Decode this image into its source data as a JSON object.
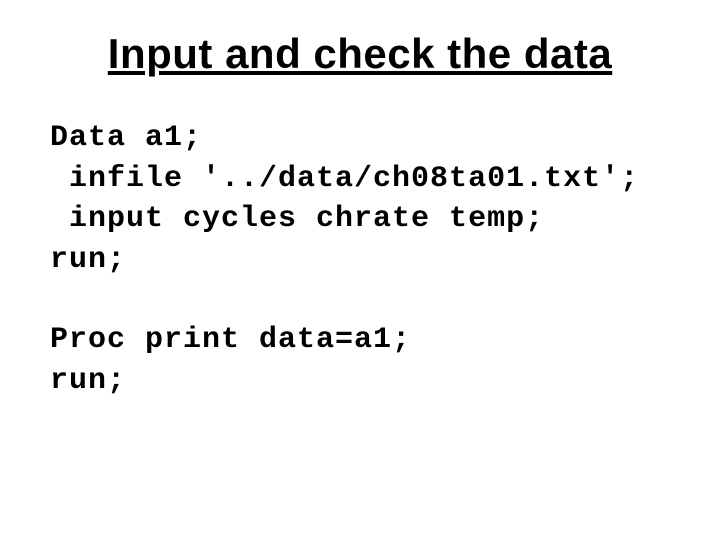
{
  "title": "Input and check the data",
  "code_blocks": [
    "Data a1;\n infile '../data/ch08ta01.txt';\n input cycles chrate temp;\nrun;",
    "Proc print data=a1;\nrun;"
  ]
}
